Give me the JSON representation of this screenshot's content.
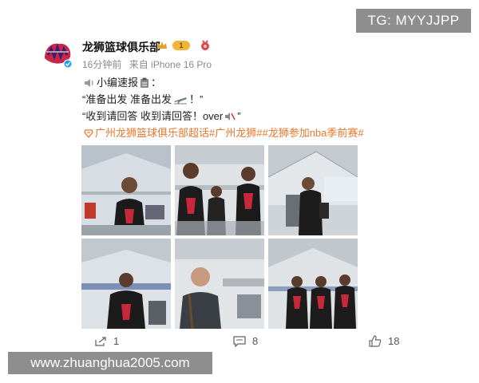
{
  "watermark_top": "TG: MYYJJPP",
  "watermark_bottom": "www.zhuanghua2005.com",
  "post": {
    "author": "龙狮篮球俱乐部",
    "vip_badge": "1",
    "time": "16分钟前",
    "source": "来自 iPhone 16 Pro",
    "lines": {
      "l1a": "小编速报",
      "l1b": "：",
      "l2a": "“准备出发 准备出发",
      "l2b": "！”",
      "l3a": "“收到请回答 收到请回答！over",
      "l3b": "”"
    },
    "hashtags": "广州龙狮篮球俱乐部超话#广州龙狮##龙狮参加nba季前赛#"
  },
  "actions": {
    "repost_count": "1",
    "comment_count": "8",
    "like_count": "18"
  },
  "icons": [
    "loudspeaker-icon",
    "clipboard-icon",
    "airplane-icon",
    "mute-icon",
    "supertopic-icon",
    "repost-icon",
    "comment-icon",
    "like-icon",
    "crown-icon",
    "medal-icon",
    "verified-icon"
  ]
}
